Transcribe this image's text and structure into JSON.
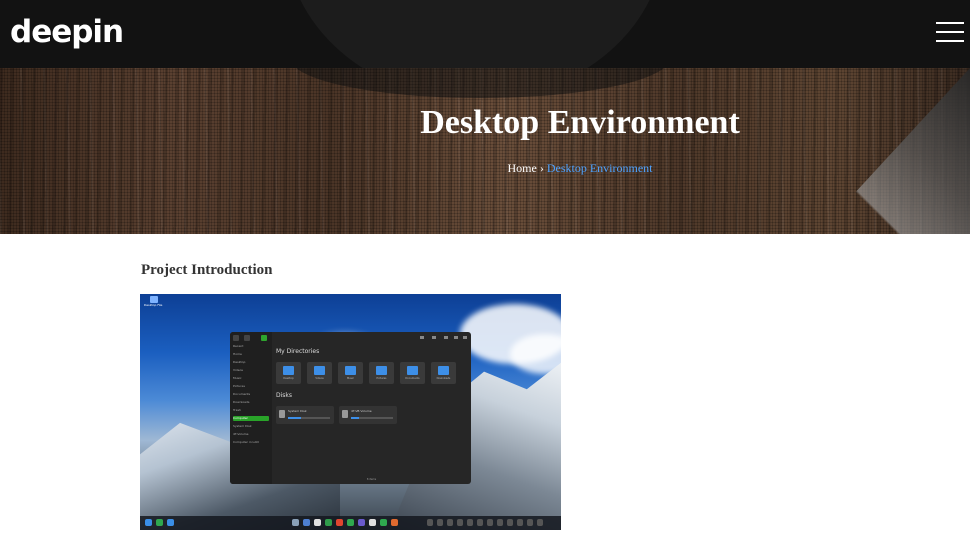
{
  "header": {
    "logo_text": "deepin",
    "menu_icon": "hamburger-menu-icon"
  },
  "banner": {
    "title": "Desktop Environment",
    "breadcrumb": {
      "home": "Home",
      "separator": "›",
      "current": "Desktop Environment"
    }
  },
  "content": {
    "section_title": "Project Introduction"
  },
  "screenshot": {
    "desktop_icon_label": "Desktop File",
    "file_manager": {
      "sidebar_items": [
        "Recent",
        "Home",
        "Desktop",
        "Videos",
        "Music",
        "Pictures",
        "Documents",
        "Downloads",
        "Trash",
        "Computer",
        "System Disk",
        "4T-Volume",
        "Computer in LAN"
      ],
      "active_item": "Computer",
      "directories_heading": "My Directories",
      "folders": [
        "Desktop",
        "Videos",
        "Music",
        "Pictures",
        "Documents",
        "Downloads"
      ],
      "disks_heading": "Disks",
      "disks": [
        {
          "name": "System Disk",
          "usage": 0.3
        },
        {
          "name": "4T-VB Volume",
          "usage": 0.2
        }
      ],
      "status_text": "8 items"
    }
  },
  "colors": {
    "topbar": "#121212",
    "breadcrumb_current": "#4fa3ff",
    "accent_green": "#29a329",
    "folder_blue": "#3d8fe8"
  }
}
